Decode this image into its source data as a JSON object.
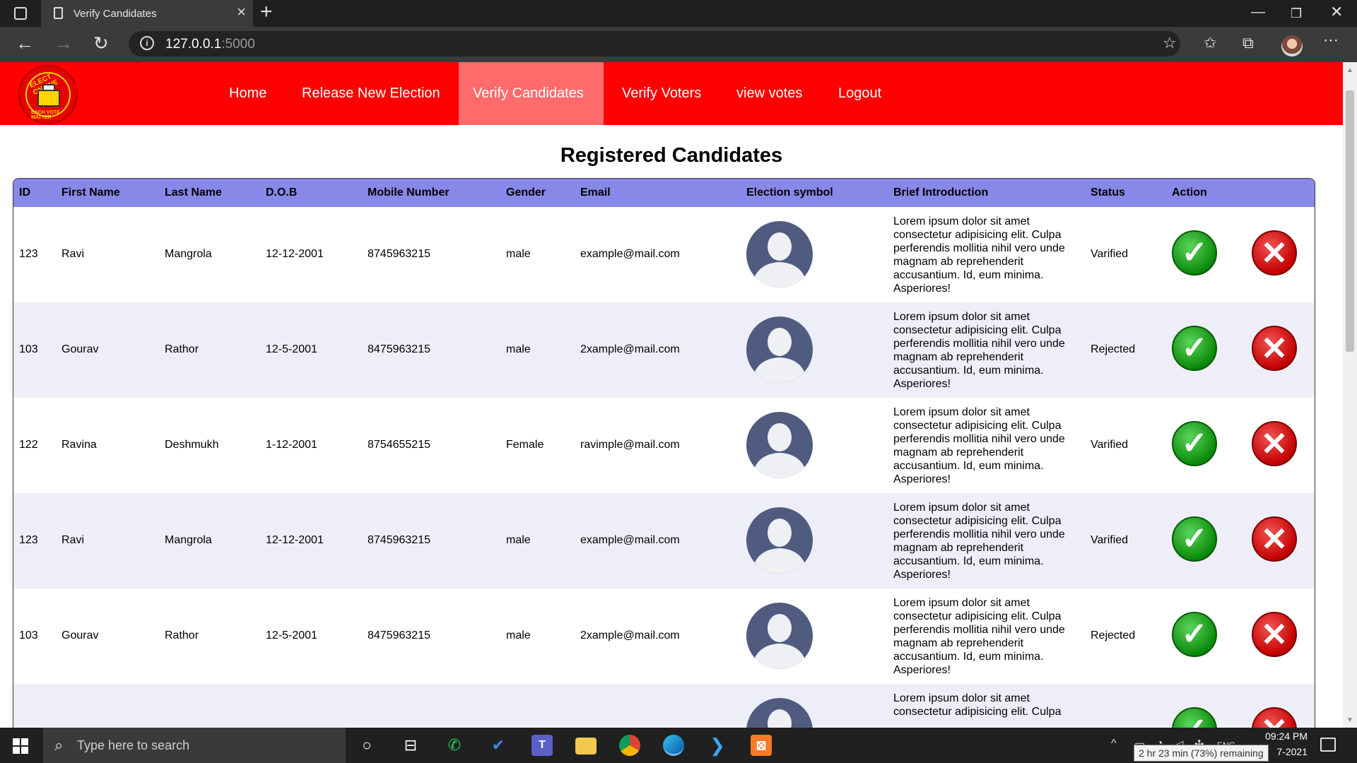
{
  "browser": {
    "tab_title": "Verify Candidates",
    "url_host": "127.0.0.1",
    "url_port": ":5000"
  },
  "navbar": {
    "logo_top": "ELECT ONLINE",
    "logo_bottom": "EACH VOTE MATTER",
    "links": [
      {
        "label": "Home"
      },
      {
        "label": "Release New Election"
      },
      {
        "label": "Verify Candidates"
      },
      {
        "label": "Verify Voters"
      },
      {
        "label": "view votes"
      },
      {
        "label": "Logout"
      }
    ]
  },
  "page": {
    "heading": "Registered Candidates"
  },
  "table": {
    "headers": [
      "ID",
      "First Name",
      "Last Name",
      "D.O.B",
      "Mobile Number",
      "Gender",
      "Email",
      "Election symbol",
      "Brief Introduction",
      "Status",
      "Action"
    ],
    "intro_text": "Lorem ipsum dolor sit amet consectetur adipisicing elit. Culpa perferendis mollitia nihil vero unde magnam ab reprehenderit accusantium. Id, eum minima. Asperiores!",
    "rows": [
      {
        "id": "123",
        "first": "Ravi",
        "last": "Mangrola",
        "dob": "12-12-2001",
        "mobile": "8745963215",
        "gender": "male",
        "email": "example@mail.com",
        "status": "Varified"
      },
      {
        "id": "103",
        "first": "Gourav",
        "last": "Rathor",
        "dob": "12-5-2001",
        "mobile": "8475963215",
        "gender": "male",
        "email": "2xample@mail.com",
        "status": "Rejected"
      },
      {
        "id": "122",
        "first": "Ravina",
        "last": "Deshmukh",
        "dob": "1-12-2001",
        "mobile": "8754655215",
        "gender": "Female",
        "email": "ravimple@mail.com",
        "status": "Varified"
      },
      {
        "id": "123",
        "first": "Ravi",
        "last": "Mangrola",
        "dob": "12-12-2001",
        "mobile": "8745963215",
        "gender": "male",
        "email": "example@mail.com",
        "status": "Varified"
      },
      {
        "id": "103",
        "first": "Gourav",
        "last": "Rathor",
        "dob": "12-5-2001",
        "mobile": "8475963215",
        "gender": "male",
        "email": "2xample@mail.com",
        "status": "Rejected"
      }
    ],
    "partial_row_intro": "Lorem ipsum dolor sit amet consectetur adipisicing elit. Culpa"
  },
  "taskbar": {
    "search_placeholder": "Type here to search",
    "time": "09:24 PM",
    "date": "7-2021",
    "battery_tooltip": "2 hr 23 min (73%) remaining",
    "lang": "ENG"
  },
  "colors": {
    "navbar": "#ff0000",
    "nav_active": "#ff6b6b",
    "table_header": "#8888e8"
  }
}
